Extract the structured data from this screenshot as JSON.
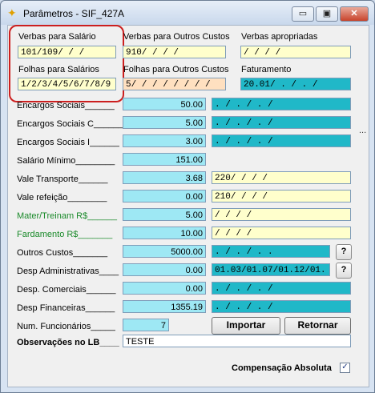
{
  "window": {
    "title": "Parâmetros - SIF_427A",
    "controls": {
      "minimize": "▭",
      "restore": "▣",
      "close": "✕"
    }
  },
  "top_groups": {
    "verbas_salario": {
      "label": "Verbas para Salário",
      "value": "101/109/   /   /"
    },
    "verbas_outros": {
      "label": "Verbas para Outros Custos",
      "value": "910/   /   /   /"
    },
    "verbas_apropriadas": {
      "label": "Verbas apropriadas",
      "value": "   /   /   /   /"
    },
    "folhas_salarios": {
      "label": "Folhas para Salários",
      "value": "1/2/3/4/5/6/7/8/9"
    },
    "folhas_outros": {
      "label": "Folhas para Outros Custos",
      "value": "5/ / / / / / / /"
    },
    "faturamento": {
      "label": "Faturamento",
      "value": "20.01/  .  /  .  /"
    }
  },
  "rows": [
    {
      "label": "Encargos Sociais______",
      "value": "50.00",
      "right": " .  / .  / .  /"
    },
    {
      "label": "Encargos Sociais C______",
      "value": "5.00",
      "right": " .  / .  / .  /"
    },
    {
      "label": "Encargos Sociais I______",
      "value": "3.00",
      "right": " .  / .  / .  /"
    },
    {
      "label": "Salário Mínimo________",
      "value": "151.00"
    },
    {
      "label": "Vale Transporte______",
      "value": "3.68",
      "right": "220/   /   /   /"
    },
    {
      "label": "Vale refeição________",
      "value": "0.00",
      "right": "210/   /   /   /"
    },
    {
      "label": "Mater/Treinam R$______",
      "value": "5.00",
      "right": "   /   /   /   /"
    },
    {
      "label": "Fardamento  R$_______",
      "value": "10.00",
      "right": "   /   /   /   /"
    },
    {
      "label": "Outros Custos_______",
      "value": "5000.00",
      "right": " .  / .  / .  ."
    },
    {
      "label": "Desp Administrativas____",
      "value": "0.00",
      "right": "01.03/01.07/01.12/01."
    },
    {
      "label": "Desp. Comerciais______",
      "value": "0.00",
      "right": " .  / .  / .  /"
    },
    {
      "label": "Desp Financeiras______",
      "value": "1355.19",
      "right": " .  / .  / .  /"
    }
  ],
  "num_funcionarios": {
    "label": "Num. Funcionários_____",
    "value": "7"
  },
  "buttons": {
    "importar": "Importar",
    "retornar": "Retornar",
    "help": "?"
  },
  "observacoes": {
    "label": "Observações no LB____",
    "value": "TESTE"
  },
  "compensacao": {
    "label": "Compensação Absoluta",
    "checked_mark": "✓"
  },
  "ellipsis": "..."
}
